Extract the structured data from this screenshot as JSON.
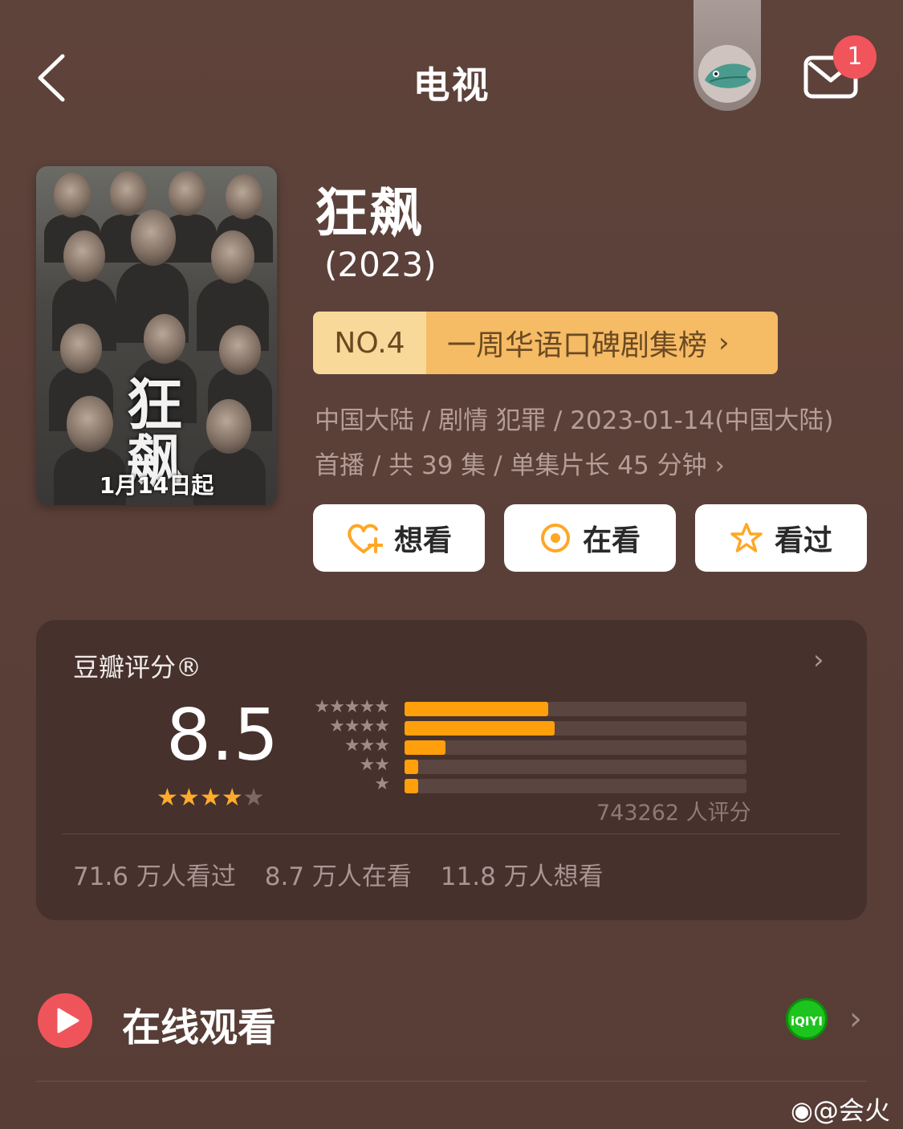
{
  "header": {
    "title": "电视",
    "mail_badge_count": "1"
  },
  "poster": {
    "big_text": "狂飙",
    "date_text": "1月14日起"
  },
  "show": {
    "title": "狂飙",
    "year": "(2023)",
    "rank_no": "NO.4",
    "rank_list": "一周华语口碑剧集榜",
    "meta_line1": "中国大陆 / 剧情 犯罪 / 2023-01-14(中国大陆)",
    "meta_line2": "首播 / 共 39 集 / 单集片长 45 分钟"
  },
  "actions": [
    {
      "label": "想看",
      "icon": "heart-plus-icon"
    },
    {
      "label": "在看",
      "icon": "target-icon"
    },
    {
      "label": "看过",
      "icon": "star-icon"
    }
  ],
  "rating": {
    "title": "豆瓣评分®",
    "score": "8.5",
    "stars": 4.5,
    "distribution": [
      {
        "stars": 5,
        "fraction": 0.42
      },
      {
        "stars": 4,
        "fraction": 0.44
      },
      {
        "stars": 3,
        "fraction": 0.12
      },
      {
        "stars": 2,
        "fraction": 0.04
      },
      {
        "stars": 1,
        "fraction": 0.04
      }
    ],
    "count_text": "743262 人评分",
    "watched": "71.6 万人看过",
    "watching": "8.7 万人在看",
    "want": "11.8 万人想看"
  },
  "online": {
    "label": "在线观看",
    "platform": "iQIYI"
  },
  "watermark": "@会火",
  "colors": {
    "background": "#5b4039",
    "accent_orange": "#ff9f0b",
    "rank_light": "#f9d99a",
    "rank_dark": "#f5bb65",
    "play_red": "#f0545b",
    "iqiyi_green": "#1ec41e"
  }
}
